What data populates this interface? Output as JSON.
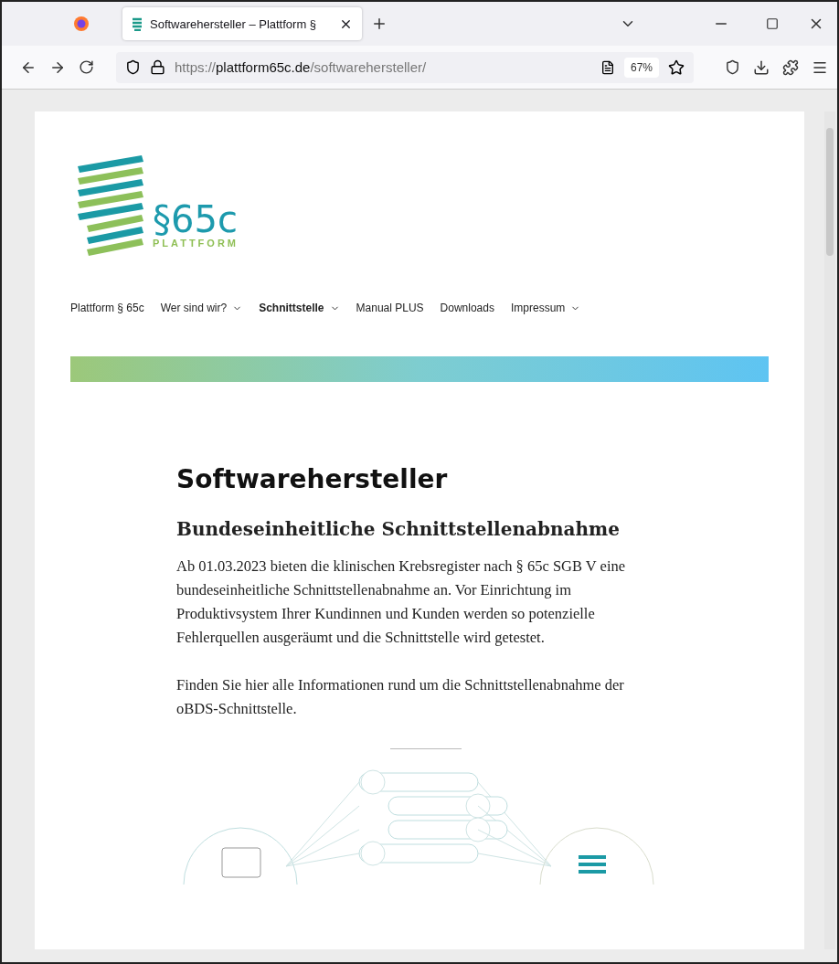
{
  "tabs": [
    {
      "title": "Softwarehersteller – Plattform §",
      "selected": true
    }
  ],
  "toolbar": {
    "url_prefix": "https://",
    "url_host": "plattform65c.de",
    "url_path": "/softwarehersteller/",
    "zoom": "67%"
  },
  "logo": {
    "mark": "§65c",
    "word": "PLATTFORM"
  },
  "nav": [
    {
      "label": "Plattform § 65c",
      "selected": false,
      "dropdown": false
    },
    {
      "label": "Wer sind wir?",
      "selected": false,
      "dropdown": true
    },
    {
      "label": "Schnittstelle",
      "selected": true,
      "dropdown": true
    },
    {
      "label": "Manual PLUS",
      "selected": false,
      "dropdown": false
    },
    {
      "label": "Downloads",
      "selected": false,
      "dropdown": false
    },
    {
      "label": "Impressum",
      "selected": false,
      "dropdown": true
    }
  ],
  "article": {
    "title": "Softwarehersteller",
    "subtitle": "Bundeseinheitliche Schnittstellenabnahme",
    "paragraphs": [
      "Ab 01.03.2023 bieten die klinischen Krebsregister nach § 65c SGB V eine bundeseinheitliche Schnittstellenabnahme an. Vor Einrichtung im Produktivsystem Ihrer Kundinnen und Kunden werden so potenzielle Fehlerquellen ausgeräumt und die Schnittstelle wird getestet.",
      "Finden Sie hier alle Informationen rund um die Schnittstellenabnahme der oBDS-Schnittstelle."
    ]
  }
}
